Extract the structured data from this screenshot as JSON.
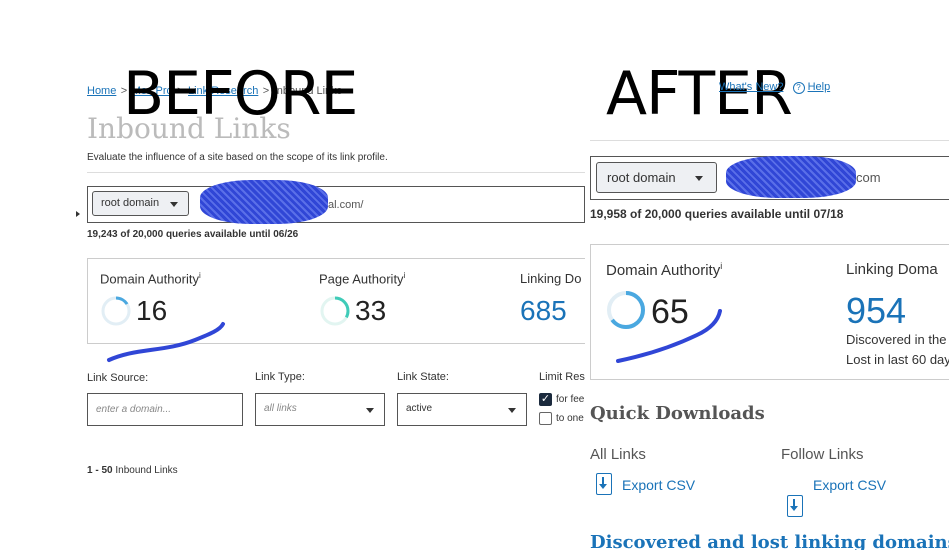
{
  "before": {
    "big_label": "BEFORE",
    "breadcrumbs": [
      "Home",
      "Moz Pro",
      "Link Research",
      "Inbound Links"
    ],
    "page_title": "Inbound Links",
    "subtitle": "Evaluate the influence of a site based on the scope of its link profile.",
    "scope_select": "root domain",
    "domain_suffix": "al.com/",
    "quota": "19,243 of 20,000 queries available until 06/26",
    "metrics": {
      "domain_authority_label": "Domain Authority",
      "domain_authority_value": "16",
      "domain_authority_fraction": 0.16,
      "page_authority_label": "Page Authority",
      "page_authority_value": "33",
      "page_authority_fraction": 0.33,
      "linking_domains_label": "Linking Do",
      "linking_domains_value": "685"
    },
    "filters": {
      "link_source_label": "Link Source:",
      "link_source_placeholder": "enter a domain...",
      "link_type_label": "Link Type:",
      "link_type_value": "all links",
      "link_state_label": "Link State:",
      "link_state_value": "active",
      "limit_label": "Limit Res",
      "checkbox1_label": "for fee",
      "checkbox1_checked": true,
      "checkbox2_label": "to one",
      "checkbox2_checked": false
    },
    "results_range": "1 - 50",
    "results_label": "Inbound Links"
  },
  "after": {
    "big_label": "AFTER",
    "whats_new": "What's New?",
    "help": "Help",
    "scope_select": "root domain",
    "domain_suffix": "com",
    "quota": "19,958 of 20,000 queries available until 07/18",
    "metrics": {
      "domain_authority_label": "Domain Authority",
      "domain_authority_value": "65",
      "domain_authority_fraction": 0.65,
      "linking_domains_label": "Linking Doma",
      "linking_domains_value": "954",
      "discovered_text": "Discovered in the",
      "lost_text": "Lost in last 60 day"
    },
    "quick_downloads_title": "Quick Downloads",
    "all_links_label": "All Links",
    "follow_links_label": "Follow Links",
    "export_csv_1": "Export CSV",
    "export_csv_2": "Export CSV",
    "discovered_lost_title": "Discovered and lost linking domains"
  },
  "colors": {
    "link_blue": "#1a73b8",
    "scribble_blue": "#3046d6",
    "ring_blue": "#4aa8e0",
    "ring_teal": "#3fcbb8"
  }
}
